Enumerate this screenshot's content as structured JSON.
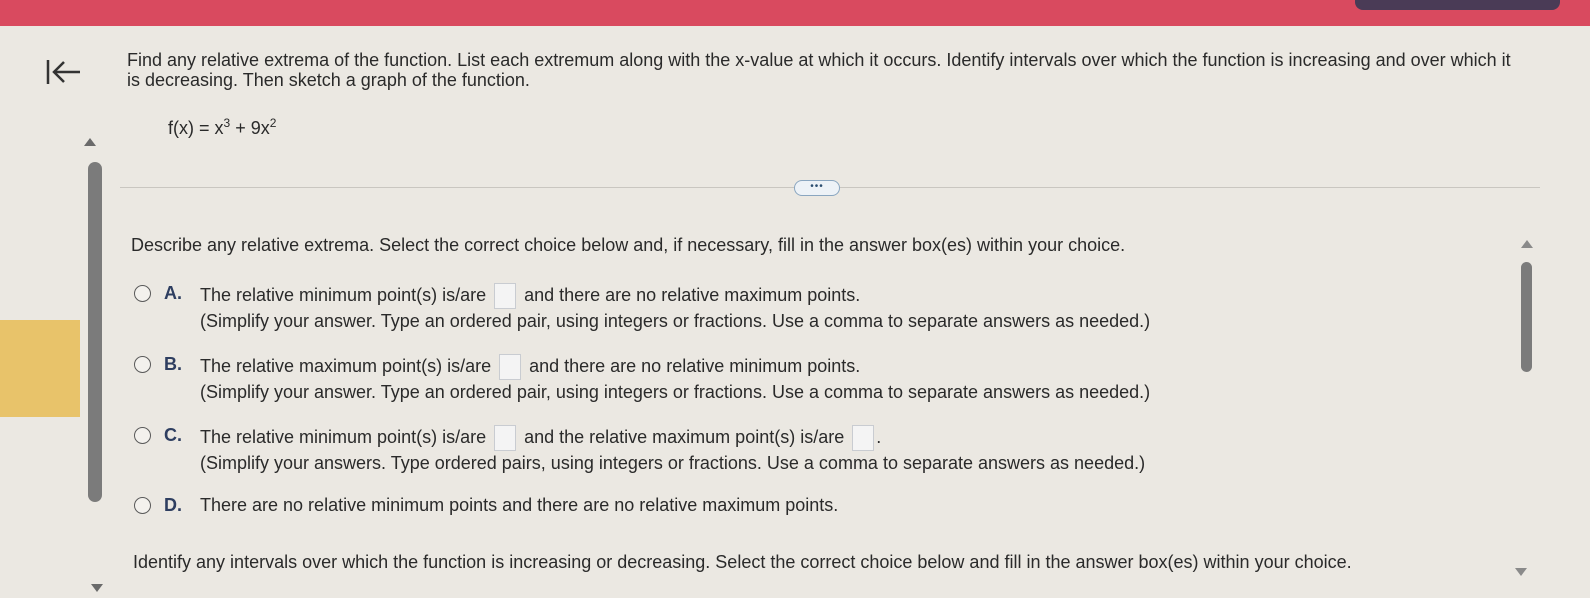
{
  "colors": {
    "topbar": "#d94a5f",
    "panel": "#ebe8e2",
    "accent_tab": "#e8c36a",
    "letter": "#2e3e60"
  },
  "nav": {
    "back_icon": "back-to-start-arrow-icon"
  },
  "question": {
    "text": "Find any relative extrema of the function. List each extremum along with the x-value at which it occurs. Identify intervals over which the function is increasing and over which it is decreasing. Then sketch a graph of the function.",
    "formula_prefix": "f(x) = x",
    "formula_exp1": "3",
    "formula_mid": " + 9x",
    "formula_exp2": "2"
  },
  "divider": {
    "more_label": "•••"
  },
  "part1": {
    "instruction": "Describe any relative extrema. Select the correct choice below and, if necessary, fill in the answer box(es) within your choice.",
    "choices": [
      {
        "letter": "A.",
        "pre": "The relative minimum point(s) is/are",
        "post": "and there are no relative maximum points.",
        "note": "(Simplify your answer. Type an ordered pair, using integers or fractions. Use a comma to separate answers as needed.)"
      },
      {
        "letter": "B.",
        "pre": "The relative maximum point(s) is/are",
        "post": "and there are no relative minimum points.",
        "note": "(Simplify your answer. Type an ordered pair, using integers or fractions. Use a comma to separate answers as needed.)"
      },
      {
        "letter": "C.",
        "pre": "The relative minimum point(s) is/are",
        "mid": "and the relative maximum point(s) is/are",
        "post": ".",
        "note": "(Simplify your answers. Type ordered pairs, using integers or fractions. Use a comma to separate answers as needed.)"
      },
      {
        "letter": "D.",
        "text": "There are no relative minimum points and there are no relative maximum points."
      }
    ]
  },
  "part2": {
    "instruction": "Identify any intervals over which the function is increasing or decreasing. Select the correct choice below and fill in the answer box(es) within your choice."
  }
}
